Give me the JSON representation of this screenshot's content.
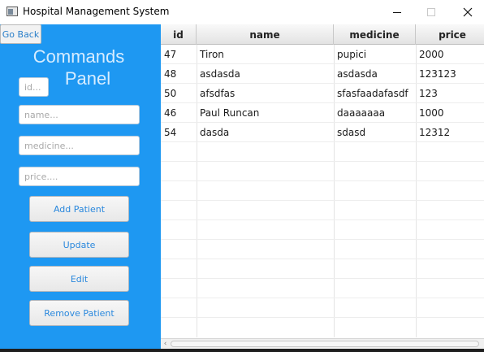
{
  "window": {
    "title": "Hospital Management System",
    "controls": {
      "minimize": "minimize-icon",
      "maximize": "maximize-icon",
      "close": "✕"
    }
  },
  "left_panel": {
    "go_back": "Go Back",
    "title_line1": "Commands",
    "title_line2": "Panel",
    "fields": {
      "id_placeholder": "id...",
      "name_placeholder": "name...",
      "medicine_placeholder": "medicine...",
      "price_placeholder": "price...."
    },
    "buttons": {
      "add": "Add Patient",
      "update": "Update",
      "edit": "Edit",
      "remove": "Remove Patient"
    }
  },
  "table": {
    "columns": [
      "id",
      "name",
      "medicine",
      "price"
    ],
    "rows": [
      {
        "id": "47",
        "name": "Tiron",
        "medicine": "pupici",
        "price": "2000"
      },
      {
        "id": "48",
        "name": "asdasda",
        "medicine": "asdasda",
        "price": "123123"
      },
      {
        "id": "50",
        "name": "afsdfas",
        "medicine": "sfasfaadafasdf",
        "price": "123"
      },
      {
        "id": "46",
        "name": "Paul Runcan",
        "medicine": "daaaaaaa",
        "price": "1000"
      },
      {
        "id": "54",
        "name": "dasda",
        "medicine": "sdasd",
        "price": "12312"
      }
    ],
    "empty_rows": 9
  },
  "colors": {
    "panel_blue": "#1e98f2",
    "button_text": "#2a88dd",
    "title_text": "#d6ecff"
  }
}
